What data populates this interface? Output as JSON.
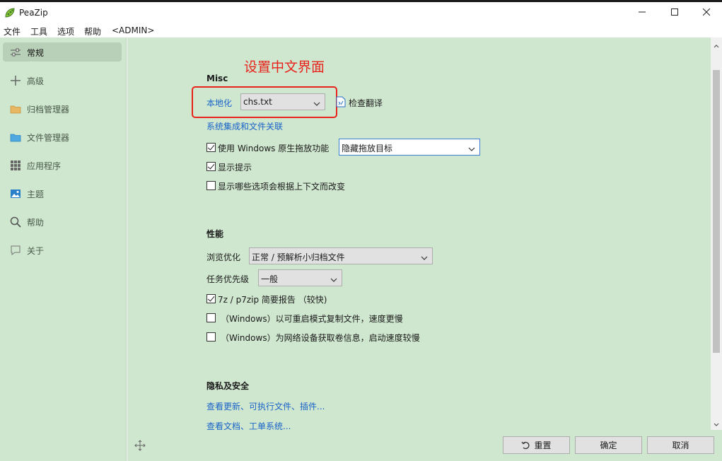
{
  "window": {
    "title": "PeaZip"
  },
  "menu": [
    "文件",
    "工具",
    "选项",
    "帮助",
    "<ADMIN>"
  ],
  "sidebar": {
    "items": [
      {
        "label": "常规",
        "icon": "general-settings-icon",
        "active": true
      },
      {
        "label": "高级",
        "icon": "plus-icon",
        "active": false
      },
      {
        "label": "归档管理器",
        "icon": "archive-folder-icon",
        "active": false
      },
      {
        "label": "文件管理器",
        "icon": "folder-icon",
        "active": false
      },
      {
        "label": "应用程序",
        "icon": "apps-grid-icon",
        "active": false
      },
      {
        "label": "主题",
        "icon": "image-icon",
        "active": false
      },
      {
        "label": "帮助",
        "icon": "search-icon",
        "active": false
      },
      {
        "label": "关于",
        "icon": "chat-bubble-icon",
        "active": false
      }
    ]
  },
  "annotation": {
    "text": "设置中文界面",
    "color": "#e8231c"
  },
  "misc": {
    "heading": "Misc",
    "localization_label": "本地化",
    "localization_value": "chs.txt",
    "check_translation": "检查翻译",
    "system_integration_link": "系统集成和文件关联",
    "drag_drop_label": "使用 Windows 原生拖放功能",
    "drag_drop_checked": true,
    "drag_drop_select": "隐藏拖放目标",
    "show_tips_label": "显示提示",
    "show_tips_checked": true,
    "show_context_label": "显示哪些选项会根据上下文而改变",
    "show_context_checked": false
  },
  "performance": {
    "heading": "性能",
    "browse_label": "浏览优化",
    "browse_value": "正常 / 预解析小归档文件",
    "priority_label": "任务优先级",
    "priority_value": "一般",
    "report_label": "7z / p7zip 简要报告 （较快)",
    "report_checked": true,
    "restart_copy_label": "（Windows）以可重启模式复制文件，速度更慢",
    "restart_copy_checked": false,
    "volume_info_label": "（Windows）为网络设备获取卷信息，启动速度较慢",
    "volume_info_checked": false
  },
  "privacy": {
    "heading": "隐私及安全",
    "updates_link": "查看更新、可执行文件、插件...",
    "docs_link": "查看文档、工单系统..."
  },
  "buttons": {
    "reset": "重置",
    "ok": "确定",
    "cancel": "取消"
  },
  "colors": {
    "panel_bg": "#cfe6cf",
    "link": "#1a64c8",
    "accent_red": "#e8231c"
  }
}
